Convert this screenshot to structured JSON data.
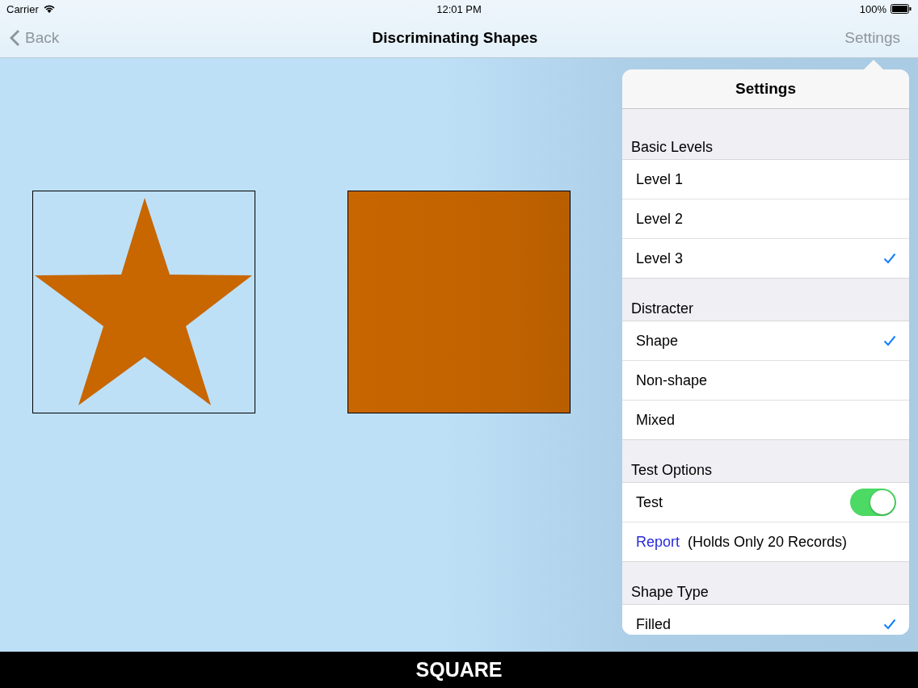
{
  "status_bar": {
    "carrier": "Carrier",
    "time": "12:01 PM",
    "battery": "100%"
  },
  "nav_bar": {
    "back": "Back",
    "title": "Discriminating Shapes",
    "settings": "Settings"
  },
  "shapes": [
    {
      "kind": "star"
    },
    {
      "kind": "square"
    }
  ],
  "popover": {
    "title": "Settings",
    "sections": [
      {
        "header": "Basic Levels",
        "rows": [
          {
            "kind": "check",
            "label": "Level 1",
            "selected": false
          },
          {
            "kind": "check",
            "label": "Level 2",
            "selected": false
          },
          {
            "kind": "check",
            "label": "Level 3",
            "selected": true
          }
        ]
      },
      {
        "header": "Distracter",
        "rows": [
          {
            "kind": "check",
            "label": "Shape",
            "selected": true
          },
          {
            "kind": "check",
            "label": "Non-shape",
            "selected": false
          },
          {
            "kind": "check",
            "label": "Mixed",
            "selected": false
          }
        ]
      },
      {
        "header": "Test Options",
        "rows": [
          {
            "kind": "switch",
            "label": "Test",
            "on": true
          },
          {
            "kind": "link",
            "link": "Report",
            "note": "(Holds Only 20 Records)"
          }
        ]
      },
      {
        "header": "Shape Type",
        "rows": [
          {
            "kind": "check",
            "label": "Filled",
            "selected": true
          }
        ]
      }
    ]
  },
  "answer_bar": {
    "label": "SQUARE"
  }
}
